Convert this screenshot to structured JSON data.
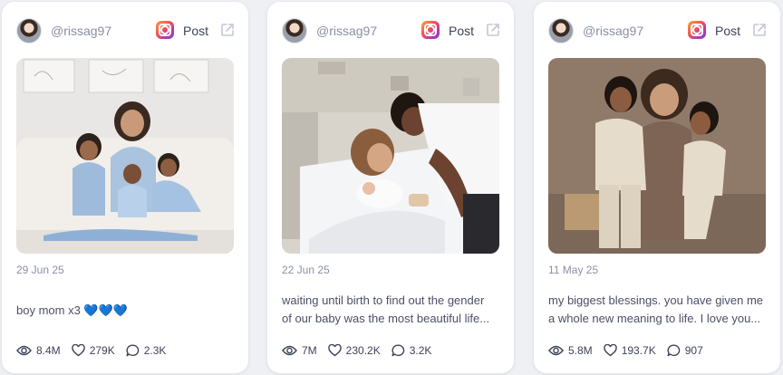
{
  "posts": [
    {
      "handle": "@rissag97",
      "post_label": "Post",
      "date": "29 Jun 25",
      "caption_lines": [
        "boy mom x3 💙💙💙"
      ],
      "views": "8.4M",
      "likes": "279K",
      "comments": "2.3K"
    },
    {
      "handle": "@rissag97",
      "post_label": "Post",
      "date": "22 Jun 25",
      "caption_lines": [
        "waiting until birth to find out the gender",
        "of our baby was the most beautiful life..."
      ],
      "views": "7M",
      "likes": "230.2K",
      "comments": "3.2K"
    },
    {
      "handle": "@rissag97",
      "post_label": "Post",
      "date": "11 May 25",
      "caption_lines": [
        "my biggest blessings. you have given me",
        "a whole new meaning to life. I love you..."
      ],
      "views": "5.8M",
      "likes": "193.7K",
      "comments": "907"
    }
  ],
  "icons": {
    "platform": "instagram-icon",
    "external": "external-link-icon",
    "views": "eye-icon",
    "likes": "heart-icon",
    "comments": "comment-icon"
  }
}
